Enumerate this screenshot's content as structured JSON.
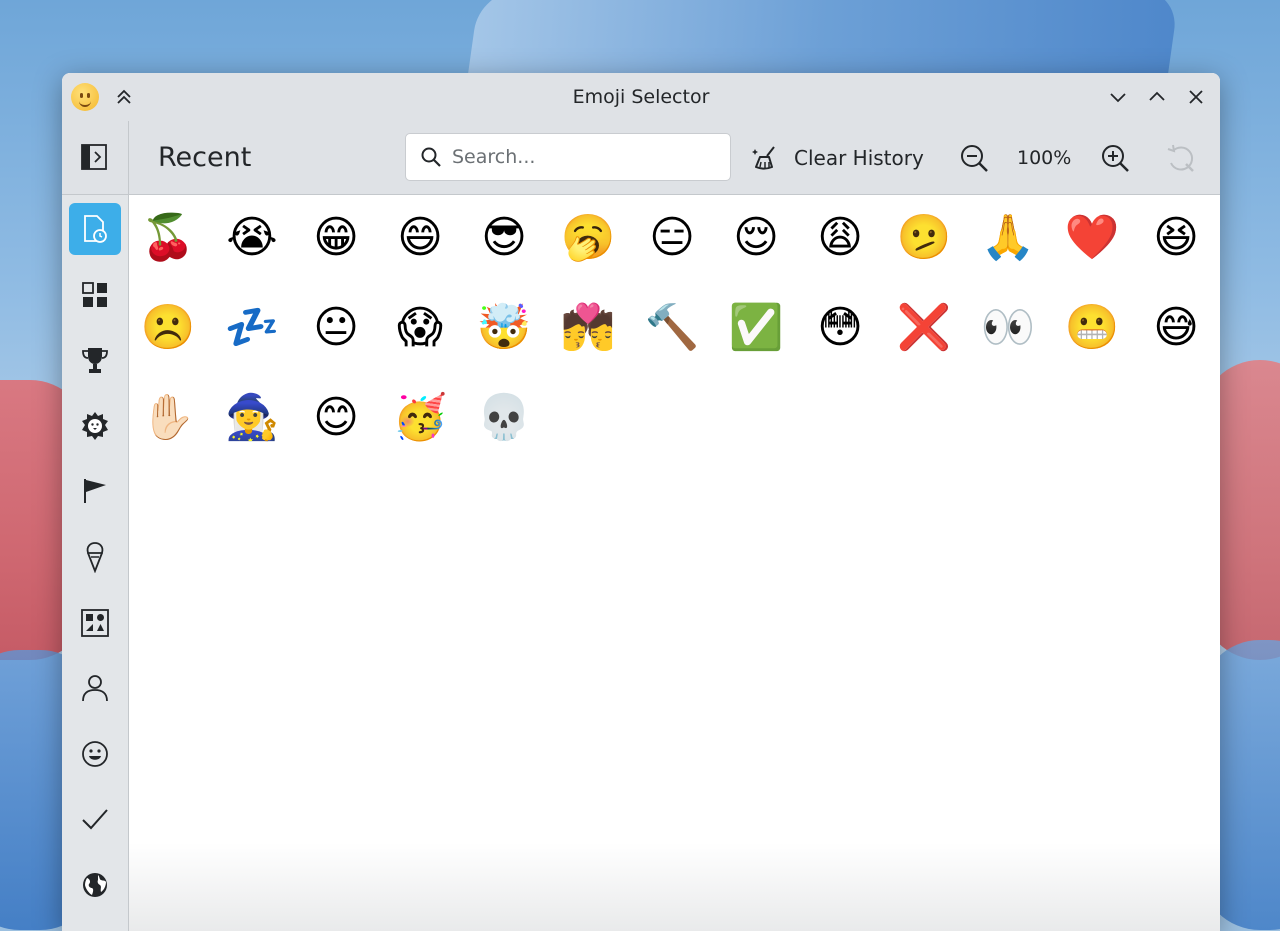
{
  "window": {
    "title": "Emoji Selector"
  },
  "header": {
    "page_title": "Recent",
    "search_placeholder": "Search...",
    "clear_history_label": "Clear History",
    "zoom_level": "100%"
  },
  "sidebar": {
    "categories": [
      {
        "icon": "recent-icon",
        "active": true
      },
      {
        "icon": "all-categories-icon"
      },
      {
        "icon": "trophy-icon"
      },
      {
        "icon": "animals-nature-icon"
      },
      {
        "icon": "flag-icon"
      },
      {
        "icon": "food-icon"
      },
      {
        "icon": "symbols-icon"
      },
      {
        "icon": "people-icon"
      },
      {
        "icon": "smileys-icon"
      },
      {
        "icon": "checkmark-icon"
      },
      {
        "icon": "travel-globe-icon"
      }
    ]
  },
  "emojis": {
    "row1": [
      "🍒",
      "😭",
      "😁",
      "😄",
      "😎",
      "🥱",
      "😑",
      "😌",
      "😩",
      "🫤",
      "🙏",
      "❤️",
      "😆"
    ],
    "row2": [
      "☹️",
      "💤",
      "😐",
      "😱",
      "🤯",
      "💏",
      "🔨",
      "✅",
      "😳",
      "❌",
      "👀",
      "😬",
      "😅"
    ],
    "row3": [
      "✋🏻",
      "🧙‍♀️",
      "😊",
      "🥳",
      "💀"
    ]
  },
  "colors": {
    "accent": "#3daee9",
    "titlebar": "#dfe2e6",
    "sidebar": "#e3e6e9"
  }
}
